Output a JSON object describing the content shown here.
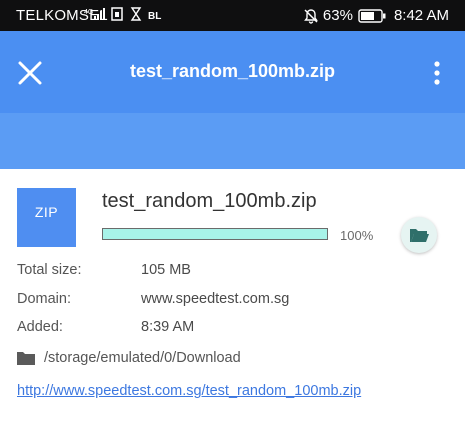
{
  "status_bar": {
    "carrier": "TELKOMSEL",
    "battery": "63%",
    "time": "8:42 AM",
    "icons": [
      "signal-4g-icon",
      "sim-icon",
      "hourglass-icon",
      "bl-icon",
      "mute-icon",
      "battery-icon"
    ],
    "indicator_text": "BL"
  },
  "app_bar": {
    "title": "test_random_100mb.zip",
    "close_icon": "close-icon",
    "menu_icon": "more-vert-icon",
    "color": "#4b8ff2",
    "sub_color": "#5b9cf4"
  },
  "download": {
    "thumb_label": "ZIP",
    "file_name": "test_random_100mb.zip",
    "progress": 1.0,
    "progress_label": "100%",
    "fill_color": "#a8f3e9",
    "open_folder_icon": "folder-open-icon"
  },
  "details": {
    "total_size_label": "Total size:",
    "total_size": "105 MB",
    "domain_label": "Domain:",
    "domain": "www.speedtest.com.sg",
    "added_label": "Added:",
    "added": "8:39 AM",
    "path": "/storage/emulated/0/Download",
    "url": "http://www.speedtest.com.sg/test_random_100mb.zip"
  }
}
